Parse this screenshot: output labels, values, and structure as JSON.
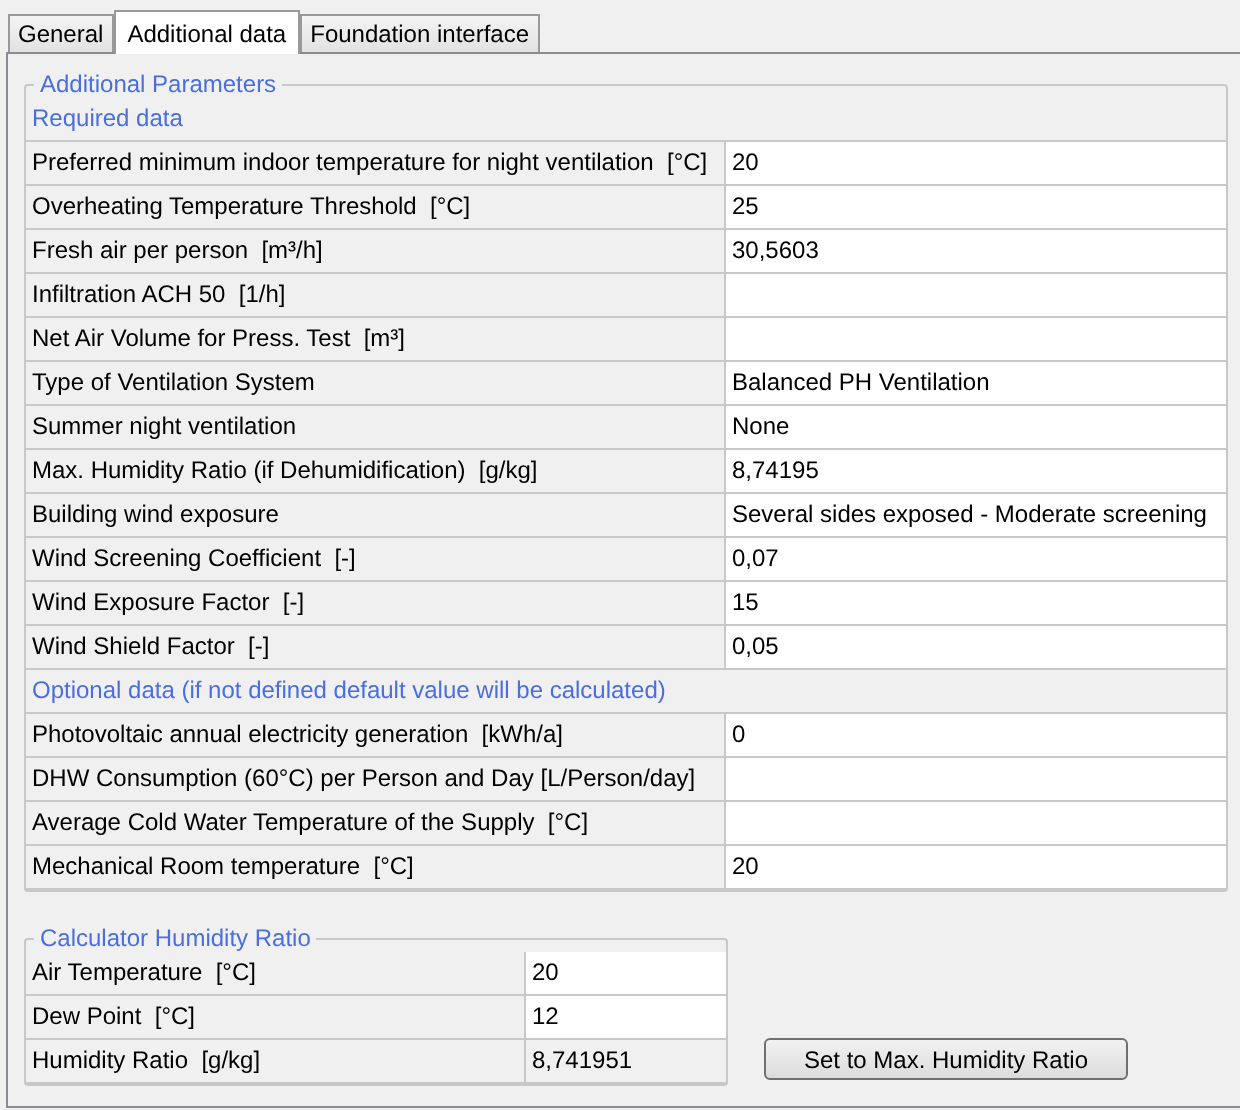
{
  "tabs": [
    {
      "label": "General",
      "selected": false
    },
    {
      "label": "Additional data",
      "selected": true
    },
    {
      "label": "Foundation interface",
      "selected": false
    }
  ],
  "parameters": {
    "title": "Additional Parameters",
    "rows": [
      {
        "kind": "section",
        "label": "Required data"
      },
      {
        "kind": "field",
        "label": "Preferred minimum indoor temperature for night ventilation  [°C]",
        "value": "20"
      },
      {
        "kind": "field",
        "label": "Overheating Temperature Threshold  [°C]",
        "value": "25"
      },
      {
        "kind": "field",
        "label": "Fresh air per person  [m³/h]",
        "value": "30,5603"
      },
      {
        "kind": "field",
        "label": "Infiltration ACH 50  [1/h]"
      },
      {
        "kind": "field",
        "label": "Net Air Volume for Press. Test  [m³]"
      },
      {
        "kind": "field",
        "label": "Type of Ventilation System",
        "value": "Balanced PH Ventilation"
      },
      {
        "kind": "field",
        "label": "Summer night ventilation",
        "value": "None"
      },
      {
        "kind": "field",
        "label": "Max. Humidity Ratio (if Dehumidification)  [g/kg]",
        "value": "8,74195"
      },
      {
        "kind": "field",
        "label": "Building wind exposure",
        "value": "Several sides exposed - Moderate screening"
      },
      {
        "kind": "field",
        "label": "Wind Screening Coefficient  [-]",
        "value": "0,07"
      },
      {
        "kind": "field",
        "label": "Wind Exposure Factor  [-]",
        "value": "15"
      },
      {
        "kind": "field",
        "label": "Wind Shield Factor  [-]",
        "value": "0,05"
      },
      {
        "kind": "section",
        "label": "Optional data (if not defined default value will be calculated)"
      },
      {
        "kind": "field",
        "label": "Photovoltaic annual electricity generation  [kWh/a]",
        "value": "0"
      },
      {
        "kind": "field",
        "label": "DHW Consumption (60°C) per Person and Day [L/Person/day]"
      },
      {
        "kind": "field",
        "label": "Average Cold Water Temperature of the Supply  [°C]"
      },
      {
        "kind": "field",
        "label": "Mechanical Room temperature  [°C]",
        "value": "20"
      }
    ]
  },
  "calculator": {
    "title": "Calculator Humidity Ratio",
    "rows": [
      {
        "label": "Air Temperature  [°C]",
        "value": "20",
        "editable": true
      },
      {
        "label": "Dew Point  [°C]",
        "value": "12",
        "editable": true
      },
      {
        "label": "Humidity Ratio  [g/kg]",
        "value": "8,741951",
        "editable": false
      }
    ]
  },
  "button": "Set to Max. Humidity Ratio"
}
